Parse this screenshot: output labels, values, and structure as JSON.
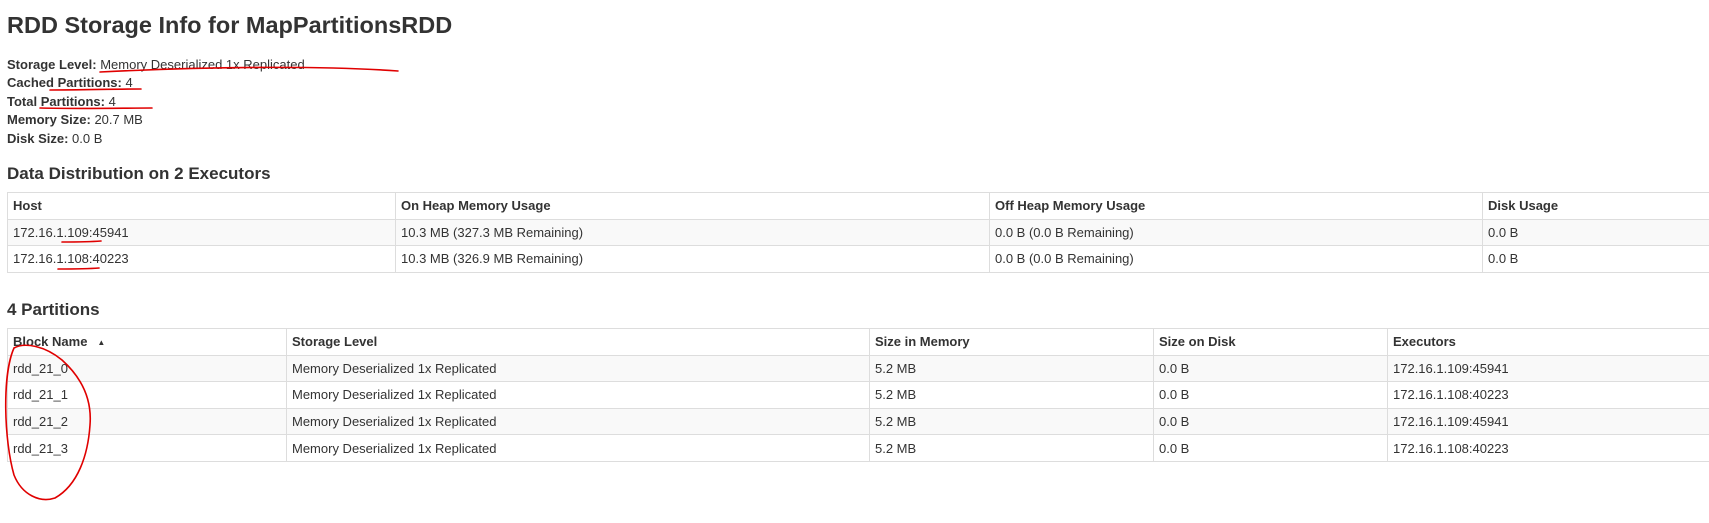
{
  "page": {
    "title": "RDD Storage Info for MapPartitionsRDD"
  },
  "summary": {
    "storage_level_label": "Storage Level:",
    "storage_level_value": "Memory Deserialized 1x Replicated",
    "cached_partitions_label": "Cached Partitions:",
    "cached_partitions_value": "4",
    "total_partitions_label": "Total Partitions:",
    "total_partitions_value": "4",
    "memory_size_label": "Memory Size:",
    "memory_size_value": "20.7 MB",
    "disk_size_label": "Disk Size:",
    "disk_size_value": "0.0 B"
  },
  "executors": {
    "heading": "Data Distribution on 2 Executors",
    "columns": [
      "Host",
      "On Heap Memory Usage",
      "Off Heap Memory Usage",
      "Disk Usage"
    ],
    "rows": [
      [
        "172.16.1.109:45941",
        "10.3 MB (327.3 MB Remaining)",
        "0.0 B (0.0 B Remaining)",
        "0.0 B"
      ],
      [
        "172.16.1.108:40223",
        "10.3 MB (326.9 MB Remaining)",
        "0.0 B (0.0 B Remaining)",
        "0.0 B"
      ]
    ]
  },
  "partitions": {
    "heading": "4 Partitions",
    "sort_indicator": "▲",
    "columns": [
      "Block Name",
      "Storage Level",
      "Size in Memory",
      "Size on Disk",
      "Executors"
    ],
    "rows": [
      [
        "rdd_21_0",
        "Memory Deserialized 1x Replicated",
        "5.2 MB",
        "0.0 B",
        "172.16.1.109:45941"
      ],
      [
        "rdd_21_1",
        "Memory Deserialized 1x Replicated",
        "5.2 MB",
        "0.0 B",
        "172.16.1.108:40223"
      ],
      [
        "rdd_21_2",
        "Memory Deserialized 1x Replicated",
        "5.2 MB",
        "0.0 B",
        "172.16.1.109:45941"
      ],
      [
        "rdd_21_3",
        "Memory Deserialized 1x Replicated",
        "5.2 MB",
        "0.0 B",
        "172.16.1.108:40223"
      ]
    ]
  },
  "colors": {
    "text": "#333333",
    "border": "#dddddd",
    "stripe": "#f9f9f9",
    "annotation_ink": "#e00000"
  }
}
